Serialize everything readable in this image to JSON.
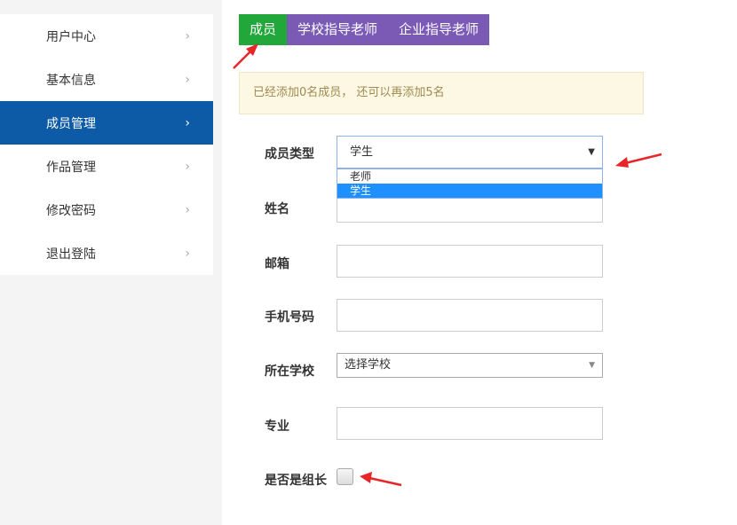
{
  "sidebar": {
    "items": [
      {
        "label": "用户中心",
        "chevron": "›"
      },
      {
        "label": "基本信息",
        "chevron": "›"
      },
      {
        "label": "成员管理",
        "chevron": "›",
        "active": true
      },
      {
        "label": "作品管理",
        "chevron": "›"
      },
      {
        "label": "修改密码",
        "chevron": "›"
      },
      {
        "label": "退出登陆",
        "chevron": "›"
      }
    ]
  },
  "tabs": [
    {
      "label": "成员",
      "color": "#22a83a"
    },
    {
      "label": "学校指导老师",
      "color": "#7b5ab6"
    },
    {
      "label": "企业指导老师",
      "color": "#7b5ab6"
    }
  ],
  "notice": "已经添加0名成员， 还可以再添加5名",
  "form": {
    "member_type": {
      "label": "成员类型",
      "value": "学生",
      "options": [
        "老师",
        "学生"
      ],
      "selected_option": "学生"
    },
    "name_label": "姓名",
    "email_label": "邮箱",
    "phone_label": "手机号码",
    "school": {
      "label": "所在学校",
      "value": "选择学校"
    },
    "major_label": "专业",
    "leader_label": "是否是组长"
  },
  "colors": {
    "accent_blue": "#0d5aa7",
    "tab_green": "#22a83a",
    "tab_purple": "#7b5ab6",
    "annotation_red": "#e8262a"
  }
}
